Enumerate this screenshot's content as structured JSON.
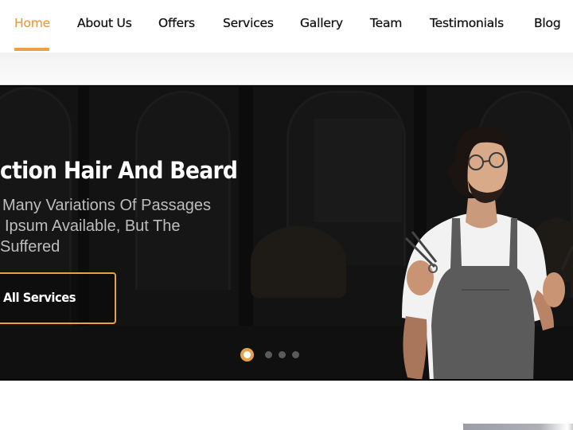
{
  "navbar": {
    "items": [
      {
        "label": "Home",
        "active": true
      },
      {
        "label": "About Us",
        "active": false
      },
      {
        "label": "Offers",
        "active": false
      },
      {
        "label": "Services",
        "active": false
      },
      {
        "label": "Gallery",
        "active": false
      },
      {
        "label": "Team",
        "active": false
      },
      {
        "label": "Testimonials",
        "active": false
      },
      {
        "label": "Blog",
        "active": false
      }
    ]
  },
  "hero": {
    "title": "ction Hair And Beard",
    "description_lines": [
      "Many Variations Of Passages",
      "Ipsum Available, But The",
      "Suffered"
    ],
    "button_label": "All Services",
    "carousel": {
      "total_slides": 4,
      "active_index": 0
    }
  },
  "colors": {
    "accent": "#e8a04a",
    "nav_text": "#111111",
    "hero_bg": "#131313",
    "hero_title": "#ffffff",
    "hero_desc": "#bdbdbd"
  },
  "icons": {
    "carousel_dot_active": "filled-circle-with-ring",
    "carousel_dot": "filled-circle"
  }
}
